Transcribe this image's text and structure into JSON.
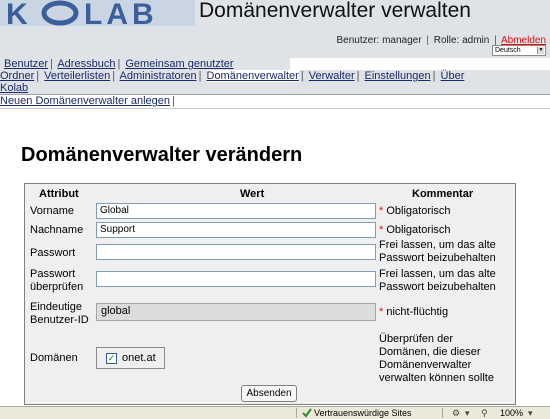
{
  "header": {
    "logo_text": "KOLAB",
    "title": "Domänenverwalter verwalten",
    "user_label": "Benutzer:",
    "user_value": "manager",
    "role_label": "Rolle:",
    "role_value": "admin",
    "logout": "Abmelden",
    "language": "Deutsch"
  },
  "menu1": [
    "Benutzer",
    "Adressbuch",
    "Gemeinsam genutzter"
  ],
  "menu2": [
    "Ordner",
    "Verteilerlisten",
    "Administratoren",
    "Domänenverwalter",
    "Verwalter",
    "Einstellungen",
    "Über",
    "Kolab"
  ],
  "submenu": {
    "new_link": "Neuen Domänenverwalter anlegen"
  },
  "main": {
    "heading": "Domänenverwalter verändern",
    "columns": {
      "attr": "Attribut",
      "value": "Wert",
      "comment": "Kommentar"
    },
    "rows": {
      "firstname": {
        "label": "Vorname",
        "value": "Global",
        "comment": "Obligatorisch"
      },
      "lastname": {
        "label": "Nachname",
        "value": "Support",
        "comment": "Obligatorisch"
      },
      "password": {
        "label": "Passwort",
        "value": "",
        "comment_1": "Frei lassen, um das alte",
        "comment_2": "Passwort beizubehalten"
      },
      "password_verify": {
        "label_1": "Passwort",
        "label_2": "überprüfen",
        "value": "",
        "comment_1": "Frei lassen, um das alte",
        "comment_2": "Passwort beizubehalten"
      },
      "userid": {
        "label_1": "Eindeutige",
        "label_2": "Benutzer-ID",
        "value": "global",
        "comment": "nicht-flüchtig"
      },
      "domains": {
        "label": "Domänen",
        "domain": "onet.at",
        "checked": true,
        "comment_1": "Überprüfen der",
        "comment_2": "Domänen, die dieser",
        "comment_3": "Domänenverwalter",
        "comment_4": "verwalten können sollte"
      }
    },
    "submit": "Absenden"
  },
  "statusbar": {
    "zone": "Vertrauenswürdige Sites",
    "zoom": "100%"
  },
  "colors": {
    "header_bg": "#dfe3e8",
    "form_bg": "#efefef",
    "link": "#1a2a6a",
    "required": "#dd1111"
  }
}
